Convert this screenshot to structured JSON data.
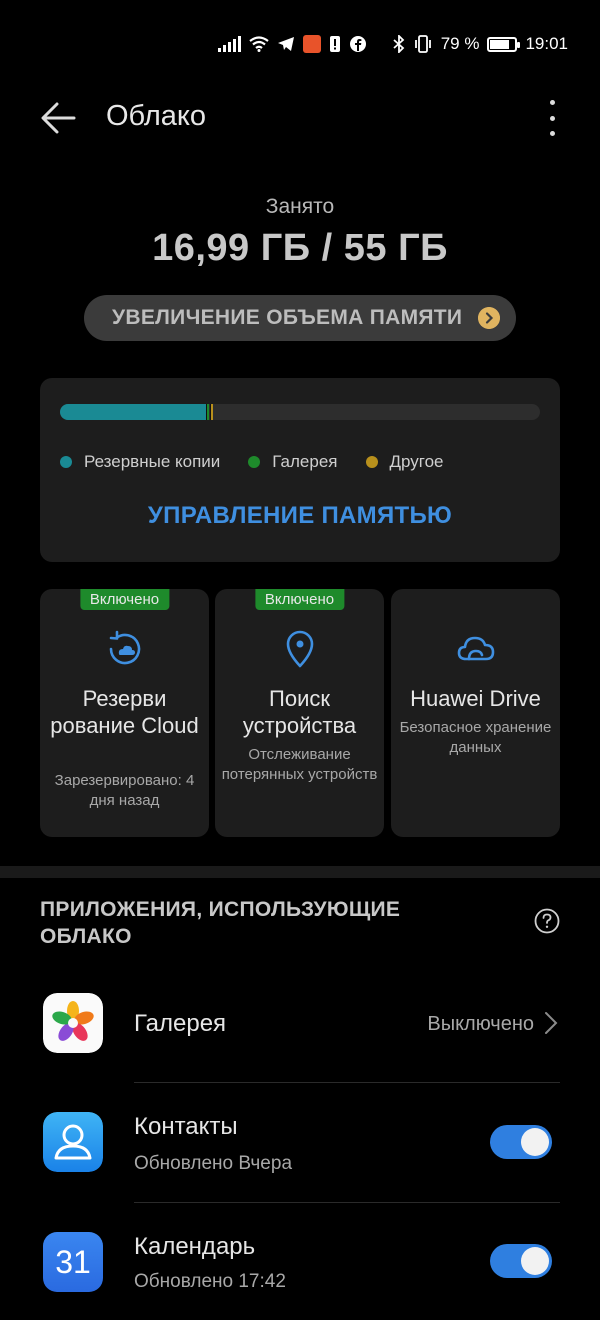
{
  "status_bar": {
    "battery_percent": "79 %",
    "time": "19:01",
    "battery_level": 0.79,
    "icons": [
      "signal-icon",
      "wifi-icon",
      "telegram-icon",
      "aliexpress-icon",
      "alert-icon",
      "facebook-icon",
      "bluetooth-icon",
      "vibrate-icon",
      "battery-icon"
    ]
  },
  "header": {
    "title": "Облако",
    "back_icon": "arrow-left-icon",
    "menu_icon": "more-vert-icon"
  },
  "storage": {
    "used_label": "Занято",
    "used_value": "16,99 ГБ / 55 ГБ",
    "upgrade_label": "УВЕЛИЧЕНИЕ ОБЪЕМА ПАМЯТИ",
    "segments": [
      {
        "name": "backups",
        "fraction": 0.305,
        "color": "#1a8a94"
      },
      {
        "name": "gallery",
        "fraction": 0.006,
        "color": "#1e8a2b"
      },
      {
        "name": "other",
        "fraction": 0.006,
        "color": "#b8901c"
      }
    ],
    "legend": [
      {
        "label": "Резервные копии",
        "color": "#1a8a94"
      },
      {
        "label": "Галерея",
        "color": "#1e8a2b"
      },
      {
        "label": "Другое",
        "color": "#b8901c"
      }
    ],
    "manage_label": "УПРАВЛЕНИЕ ПАМЯТЬЮ"
  },
  "tiles": [
    {
      "badge": "Включено",
      "title": "Резерви рование Cloud",
      "subtitle": "Зарезервировано: 4 дня назад",
      "icon": "cloud-backup-icon"
    },
    {
      "badge": "Включено",
      "title": "Поиск устройства",
      "subtitle": "Отслеживание потерянных устройств",
      "icon": "location-pin-icon"
    },
    {
      "badge": "",
      "title": "Huawei Drive",
      "subtitle": "Безопасное хранение данных",
      "icon": "cloud-icon"
    }
  ],
  "apps_section": {
    "title": "ПРИЛОЖЕНИЯ, ИСПОЛЬЗУЮЩИЕ ОБЛАКО",
    "help_icon": "help-circle-icon",
    "apps": [
      {
        "name": "Галерея",
        "status": "Выключено",
        "icon": "gallery-icon"
      },
      {
        "name": "Контакты",
        "subtitle": "Обновлено Вчера",
        "enabled": true,
        "icon": "contacts-icon"
      },
      {
        "name": "Календарь",
        "subtitle": "Обновлено 17:42",
        "enabled": true,
        "icon": "calendar-icon",
        "icon_text": "31"
      }
    ]
  },
  "colors": {
    "accent": "#3f8fe0",
    "toggle_on": "#2f7fe0",
    "badge_green": "#1e8a2b",
    "card_bg": "#1d1d1d"
  }
}
